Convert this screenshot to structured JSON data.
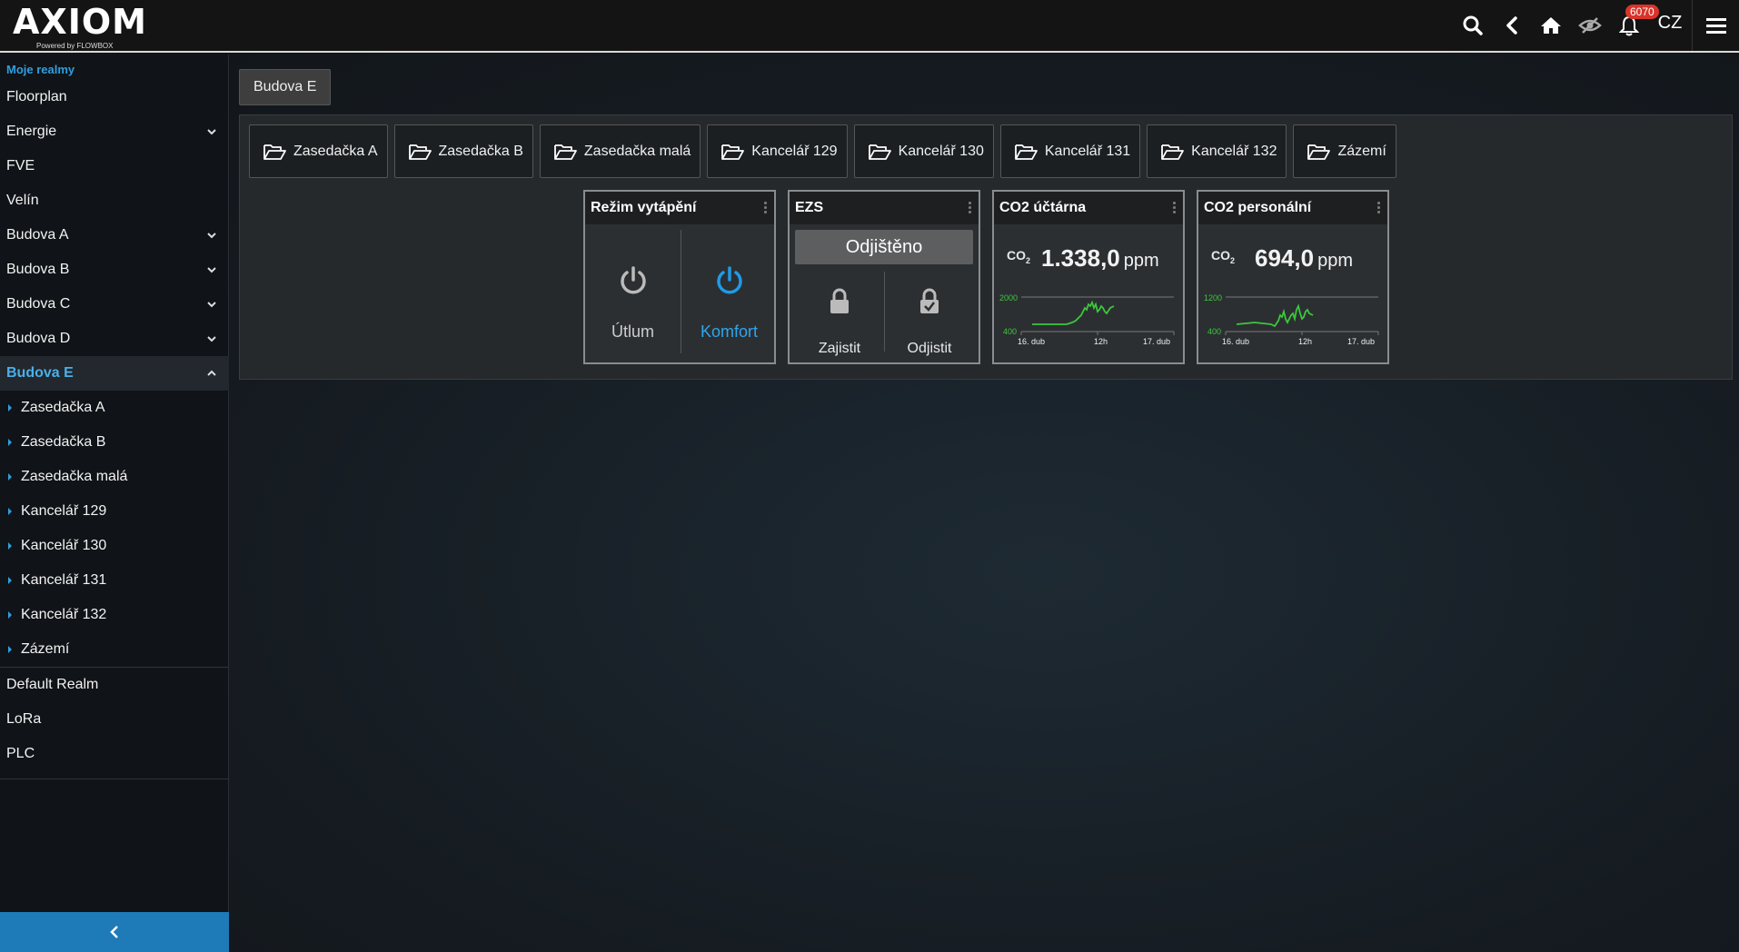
{
  "app": {
    "brand": "AXIOM",
    "powered_by": "Powered by FLOWBOX",
    "notification_count": "6070",
    "language": "CZ"
  },
  "sidebar": {
    "heading": "Moje realmy",
    "items": [
      {
        "label": "Floorplan",
        "expandable": false
      },
      {
        "label": "Energie",
        "expandable": true
      },
      {
        "label": "FVE",
        "expandable": false
      },
      {
        "label": "Velín",
        "expandable": false
      },
      {
        "label": "Budova A",
        "expandable": true
      },
      {
        "label": "Budova B",
        "expandable": true
      },
      {
        "label": "Budova C",
        "expandable": true
      },
      {
        "label": "Budova D",
        "expandable": true
      },
      {
        "label": "Budova E",
        "expandable": true,
        "active": true
      }
    ],
    "sub_items": [
      "Zasedačka A",
      "Zasedačka B",
      "Zasedačka malá",
      "Kancelář 129",
      "Kancelář 130",
      "Kancelář 131",
      "Kancelář 132",
      "Zázemí"
    ],
    "other_items": [
      "Default Realm",
      "LoRa",
      "PLC"
    ]
  },
  "breadcrumb": "Budova E",
  "tabs": [
    "Zasedačka A",
    "Zasedačka B",
    "Zasedačka malá",
    "Kancelář 129",
    "Kancelář 130",
    "Kancelář 131",
    "Kancelář 132",
    "Zázemí"
  ],
  "widgets": {
    "heating": {
      "title": "Režim vytápění",
      "off_label": "Útlum",
      "on_label": "Komfort",
      "active": "Komfort"
    },
    "ezs": {
      "title": "EZS",
      "status": "Odjištěno",
      "lock_label": "Zajistit",
      "unlock_label": "Odjistit"
    },
    "co2_accounting": {
      "title": "CO2 účtárna",
      "symbol": "CO",
      "symbol_sub": "2",
      "value": "1.338,0",
      "unit": "ppm",
      "y_max": "2000",
      "y_min": "400",
      "x_ticks": [
        "16. dub",
        "12h",
        "17. dub"
      ]
    },
    "co2_personnel": {
      "title": "CO2 personální",
      "symbol": "CO",
      "symbol_sub": "2",
      "value": "694,0",
      "unit": "ppm",
      "y_max": "1200",
      "y_min": "400",
      "x_ticks": [
        "16. dub",
        "12h",
        "17. dub"
      ]
    }
  },
  "colors": {
    "accent": "#2e9fe0",
    "active_blue": "#1e9be6",
    "chart_line": "#3cc83c",
    "badge": "#d9342b"
  }
}
